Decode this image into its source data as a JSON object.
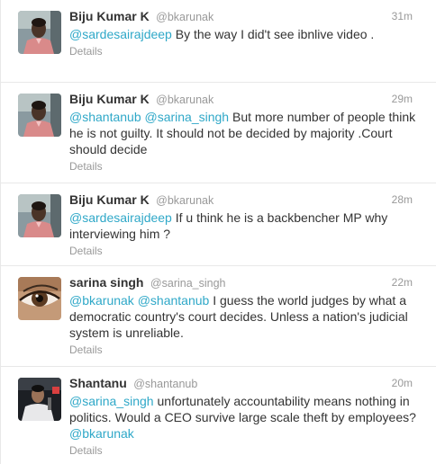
{
  "tweets": [
    {
      "fullname": "Biju Kumar K",
      "username": "@bkarunak",
      "time": "31m",
      "avatar": "person-photo-pink-shirt",
      "segments": [
        {
          "type": "mention",
          "text": "@sardesairajdeep"
        },
        {
          "type": "text",
          "text": " By the way I did't see ibnlive video ."
        }
      ],
      "details": "Details"
    },
    {
      "fullname": "Biju Kumar K",
      "username": "@bkarunak",
      "time": "29m",
      "avatar": "person-photo-pink-shirt",
      "segments": [
        {
          "type": "mention",
          "text": "@shantanub"
        },
        {
          "type": "text",
          "text": " "
        },
        {
          "type": "mention",
          "text": "@sarina_singh"
        },
        {
          "type": "text",
          "text": " But more number of people think he is not guilty. It should not be decided by majority .Court should decide"
        }
      ],
      "details": "Details"
    },
    {
      "fullname": "Biju Kumar K",
      "username": "@bkarunak",
      "time": "28m",
      "avatar": "person-photo-pink-shirt",
      "segments": [
        {
          "type": "mention",
          "text": "@sardesairajdeep"
        },
        {
          "type": "text",
          "text": " If u think he is a backbencher MP why interviewing him ?"
        }
      ],
      "details": "Details"
    },
    {
      "fullname": "sarina singh",
      "username": "@sarina_singh",
      "time": "22m",
      "avatar": "eye-closeup-photo",
      "segments": [
        {
          "type": "mention",
          "text": "@bkarunak"
        },
        {
          "type": "text",
          "text": " "
        },
        {
          "type": "mention",
          "text": "@shantanub"
        },
        {
          "type": "text",
          "text": " I guess the world judges by what a democratic country's court decides. Unless a nation's judicial system is unreliable."
        }
      ],
      "details": "Details"
    },
    {
      "fullname": "Shantanu",
      "username": "@shantanub",
      "time": "20m",
      "avatar": "person-speaking-photo",
      "segments": [
        {
          "type": "mention",
          "text": "@sarina_singh"
        },
        {
          "type": "text",
          "text": " unfortunately accountability means nothing in politics.  Would a CEO survive large scale theft by employees? "
        },
        {
          "type": "mention",
          "text": "@bkarunak"
        }
      ],
      "details": "Details"
    }
  ]
}
